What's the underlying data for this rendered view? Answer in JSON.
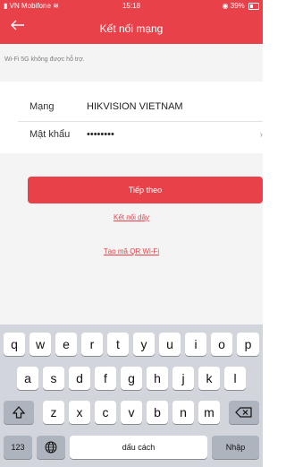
{
  "status_bar": {
    "carrier": "VN Mobifone",
    "time": "15:18",
    "battery": "39%"
  },
  "header": {
    "title": "Kết nối mạng"
  },
  "notice": "Wi-Fi 5G không được hỗ trợ.",
  "form": {
    "network_label": "Mạng",
    "network_value": "HIKVISION VIETNAM",
    "password_label": "Mật khẩu",
    "password_value": "••••••••",
    "reveal_glyph": "›"
  },
  "actions": {
    "next_label": "Tiếp theo",
    "wired_link": "Kết nối dây",
    "qr_link": "Tạo mã QR Wi-Fi"
  },
  "keyboard": {
    "row1": [
      "q",
      "w",
      "e",
      "r",
      "t",
      "y",
      "u",
      "i",
      "o",
      "p"
    ],
    "row2": [
      "a",
      "s",
      "d",
      "f",
      "g",
      "h",
      "j",
      "k",
      "l"
    ],
    "row3": [
      "z",
      "x",
      "c",
      "v",
      "b",
      "n",
      "m"
    ],
    "numbers_key": "123",
    "space_key": "dấu cách",
    "return_key": "Nhập"
  },
  "colors": {
    "accent": "#e8414a",
    "background": "#f4f4f4",
    "keyboard_bg": "#d2d5db"
  }
}
